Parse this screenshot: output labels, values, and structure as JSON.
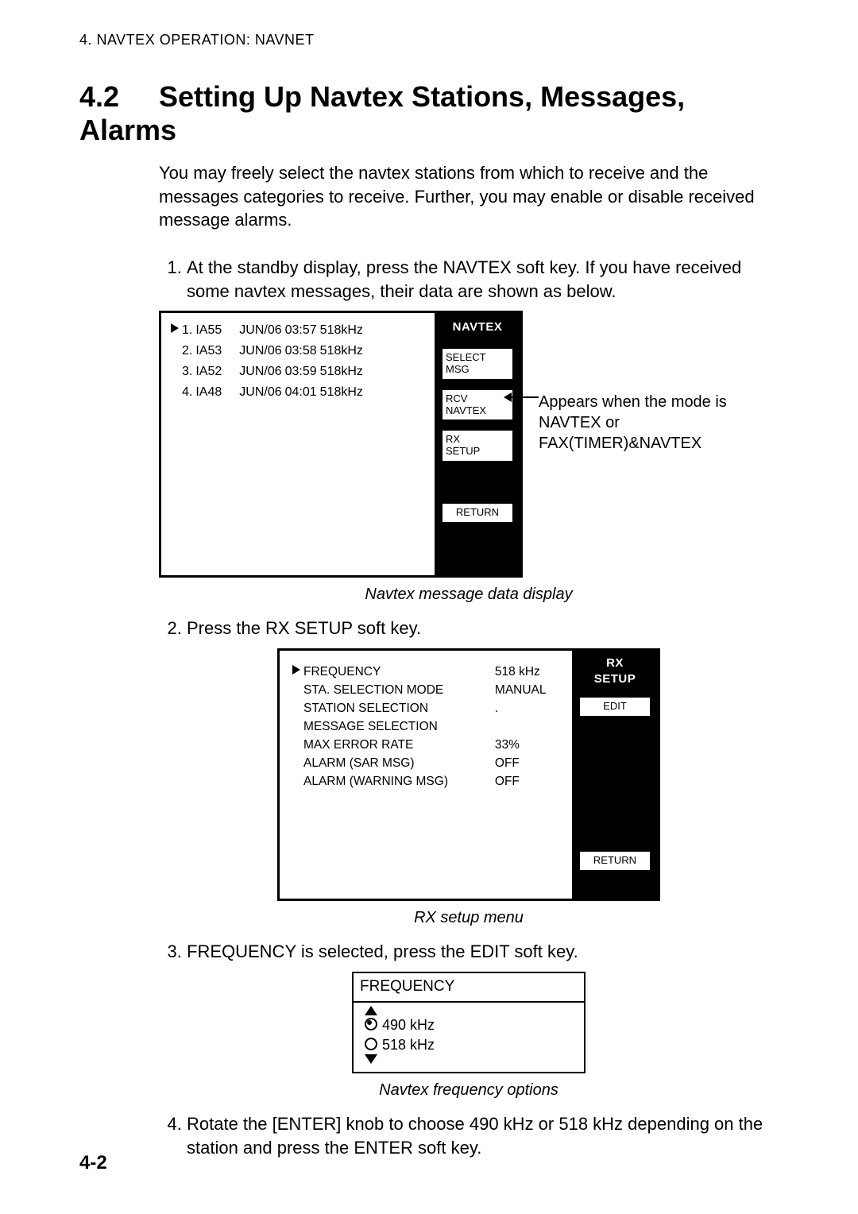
{
  "header": "4. NAVTEX OPERATION: NAVNET",
  "section": {
    "number": "4.2",
    "title": "Setting Up Navtex Stations, Messages, Alarms"
  },
  "intro": "You may freely select the navtex stations from which to receive and the messages categories to receive. Further, you may enable or disable received message alarms.",
  "steps": {
    "s1": "At the standby display, press the NAVTEX soft key. If you have received some navtex messages, their data are shown as below.",
    "s2": "Press the RX SETUP soft key.",
    "s3": "FREQUENCY is selected, press the EDIT soft key.",
    "s4": "Rotate the [ENTER] knob to choose 490 kHz or 518 kHz depending on the station and press the ENTER soft key."
  },
  "fig1": {
    "rows": [
      {
        "idx": "1.",
        "id": "IA55",
        "date": "JUN/06",
        "time": "03:57",
        "freq": "518kHz",
        "cursor": true
      },
      {
        "idx": "2.",
        "id": "IA53",
        "date": "JUN/06",
        "time": "03:58",
        "freq": "518kHz",
        "cursor": false
      },
      {
        "idx": "3.",
        "id": "IA52",
        "date": "JUN/06",
        "time": "03:59",
        "freq": "518kHz",
        "cursor": false
      },
      {
        "idx": "4.",
        "id": "IA48",
        "date": "JUN/06",
        "time": "04:01",
        "freq": "518kHz",
        "cursor": false
      }
    ],
    "soft_title": "NAVTEX",
    "soft": {
      "select_msg": "SELECT\nMSG",
      "rcv_navtex": "RCV\nNAVTEX",
      "rx_setup": "RX\nSETUP",
      "return": "RETURN"
    },
    "note": "Appears when the mode is NAVTEX or FAX(TIMER)&NAVTEX",
    "caption": "Navtex message data display"
  },
  "fig2": {
    "soft_title_a": "RX",
    "soft_title_b": "SETUP",
    "soft": {
      "edit": "EDIT",
      "return": "RETURN"
    },
    "rows": [
      {
        "label": "FREQUENCY",
        "value": "518 kHz",
        "cursor": true
      },
      {
        "label": "STA. SELECTION MODE",
        "value": "MANUAL"
      },
      {
        "label": "STATION SELECTION",
        "value": "."
      },
      {
        "label": "MESSAGE SELECTION",
        "value": ""
      },
      {
        "label": "MAX ERROR RATE",
        "value": "33%"
      },
      {
        "label": "ALARM (SAR MSG)",
        "value": "OFF"
      },
      {
        "label": "ALARM (WARNING  MSG)",
        "value": "OFF"
      }
    ],
    "caption": "RX setup menu"
  },
  "fig3": {
    "title": "FREQUENCY",
    "options": [
      {
        "label": "490 kHz",
        "selected": true
      },
      {
        "label": "518 kHz",
        "selected": false
      }
    ],
    "caption": "Navtex frequency options"
  },
  "page_num": "4-2"
}
